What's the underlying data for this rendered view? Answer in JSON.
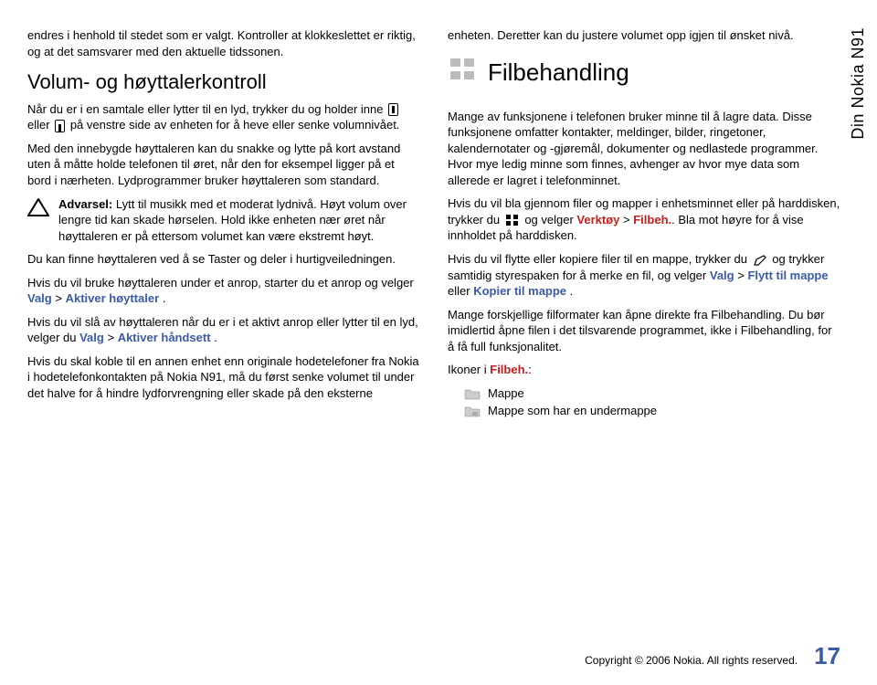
{
  "sidebarTitle": "Din Nokia N91",
  "col1": {
    "p1": "endres i henhold til stedet som er valgt. Kontroller at klokkeslettet er riktig, og at det samsvarer med den aktuelle tidssonen.",
    "h2": "Volum- og høyttalerkontroll",
    "p2a": "Når du er i en samtale eller lytter til en lyd, trykker du og holder inne ",
    "p2b": " eller ",
    "p2c": " på venstre side av enheten for å heve eller senke volumnivået.",
    "p3": "Med den innebygde høyttaleren kan du snakke og lytte på kort avstand uten å måtte holde telefonen til øret, når den for eksempel ligger på et bord i nærheten. Lydprogrammer bruker høyttaleren som standard.",
    "warnLabel": "Advarsel:",
    "warnText": " Lytt til musikk med et moderat lydnivå. Høyt volum over lengre tid kan skade hørselen. Hold ikke enheten nær øret når høyttaleren er på ettersom volumet kan være ekstremt høyt.",
    "p4": "Du kan finne høyttaleren ved å se Taster og deler i hurtigveiledningen.",
    "p5a": "Hvis du vil bruke høyttaleren under et anrop, starter du et anrop og velger ",
    "valg": "Valg",
    "gt": " > ",
    "aktiverH": "Aktiver høyttaler",
    "p5b": ".",
    "p6a": "Hvis du vil slå av høyttaleren når du er i et aktivt anrop eller lytter til en lyd, velger du ",
    "aktiverHandsett": "Aktiver håndsett",
    "p6b": ".",
    "p7": "Hvis du skal koble til en annen enhet enn originale hodetelefoner fra Nokia i hodetelefonkontakten på Nokia N91, må du først senke volumet til under det halve for å hindre lydforvrengning eller skade på den eksterne"
  },
  "col2": {
    "p1": "enheten. Deretter kan du justere volumet opp igjen til ønsket nivå.",
    "h2": "Filbehandling",
    "p2": "Mange av funksjonene i telefonen bruker minne til å lagre data. Disse funksjonene omfatter kontakter, meldinger, bilder, ringetoner, kalendernotater og -gjøremål, dokumenter og nedlastede programmer. Hvor mye ledig minne som finnes, avhenger av hvor mye data som allerede er lagret i telefonminnet.",
    "p3a": "Hvis du vil bla gjennom filer og mapper i enhetsminnet eller på harddisken, trykker du ",
    "p3b": " og velger ",
    "verktoy": "Verktøy",
    "filbeh": "Filbeh.",
    "p3c": ". Bla mot høyre for å vise innholdet på harddisken.",
    "p4a": "Hvis du vil flytte eller kopiere filer til en mappe, trykker du ",
    "p4b": " og trykker samtidig styrespaken for å merke en fil, og velger ",
    "flytt": "Flytt til mappe",
    "eller": " eller ",
    "kopier": "Kopier til mappe",
    "p4c": ".",
    "p5": "Mange forskjellige filformater kan åpne direkte fra Filbehandling. Du bør imidlertid åpne filen i det tilsvarende programmet, ikke i Filbehandling, for å få full funksjonalitet.",
    "ikonerLabel": "Ikoner i ",
    "ikonerColon": ":",
    "folder1": "Mappe",
    "folder2": "Mappe som har en undermappe"
  },
  "footer": {
    "copyright": "Copyright © 2006 Nokia. All rights reserved.",
    "page": "17"
  }
}
